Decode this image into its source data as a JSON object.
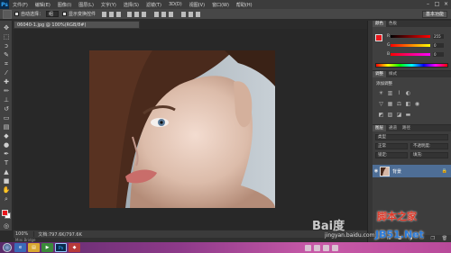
{
  "app": {
    "logo": "Ps"
  },
  "menubar": {
    "items": [
      "文件(F)",
      "编辑(E)",
      "图像(I)",
      "图层(L)",
      "文字(Y)",
      "选择(S)",
      "滤镜(T)",
      "3D(D)",
      "视图(V)",
      "窗口(W)",
      "帮助(H)"
    ],
    "minimize": "–",
    "maximize": "□",
    "close": "×"
  },
  "options": {
    "auto_select_label": "自动选择：",
    "auto_select_value": "组",
    "show_transform_label": "显示变换控件",
    "workspace": "基本功能"
  },
  "document": {
    "tab_title": "06040-1.jpg @ 100%(RGB/8#)",
    "zoom": "100%",
    "doc_size": "文档:797.6K/797.6K",
    "status_hint": "Mini Bridge"
  },
  "colors": {
    "foreground": "#e8171c",
    "background": "#ffffff"
  },
  "panels": {
    "color_tabs": [
      "颜色",
      "色板"
    ],
    "sliders": [
      {
        "label": "R",
        "value": "255"
      },
      {
        "label": "G",
        "value": "0"
      },
      {
        "label": "B",
        "value": "0"
      }
    ],
    "adjust_tabs": [
      "调整",
      "样式"
    ],
    "adjust_title": "添加调整",
    "layer_tabs": [
      "图层",
      "通道",
      "路径"
    ],
    "layer_kind": "类型",
    "blend_mode": "正常",
    "opacity": "不透明度:",
    "lock": "锁定:",
    "fill": "填充:",
    "layer_name": "背景"
  },
  "taskbar": {
    "ps_label": "Ps"
  },
  "watermarks": {
    "baidu": "Bai度",
    "jingyan": "jingyan.baidu.com",
    "jbl": "脚本之家",
    "jb51": "JB51.Net"
  }
}
